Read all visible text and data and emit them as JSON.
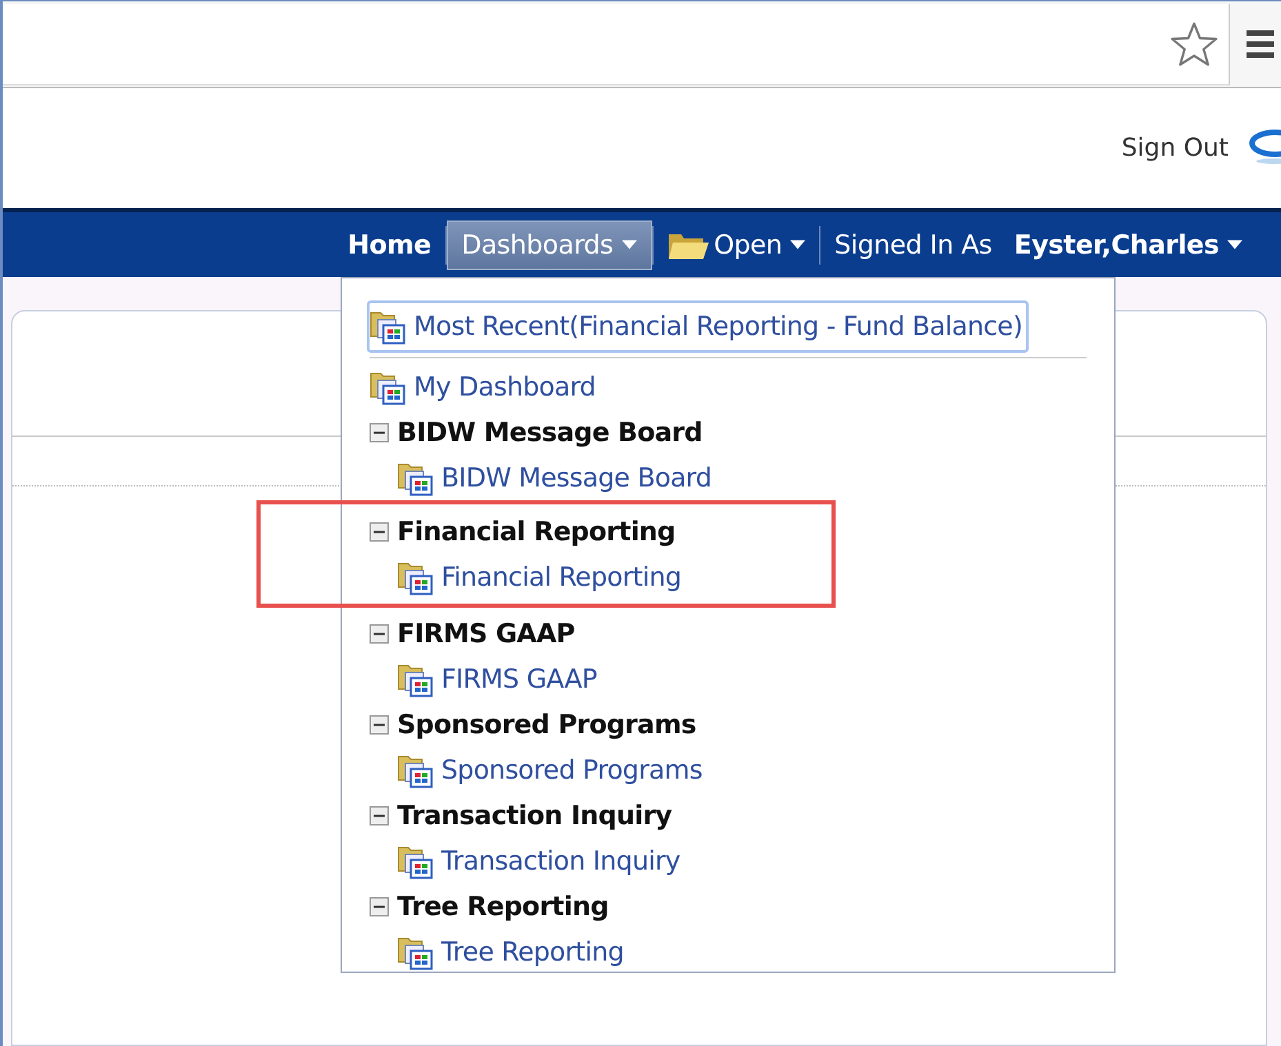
{
  "header": {
    "sign_out": "Sign Out"
  },
  "nav": [
    {
      "label": "Home",
      "kind": "link",
      "selected": false
    },
    {
      "label": "Dashboards",
      "kind": "menu",
      "selected": true
    },
    {
      "label": "Open",
      "kind": "folder-menu",
      "selected": false
    },
    {
      "label": "Signed In As",
      "kind": "caption",
      "selected": false
    },
    {
      "label": "Eyster,Charles",
      "kind": "user-menu",
      "selected": false
    }
  ],
  "menu": {
    "recent": [
      {
        "label": "Most Recent(Financial Reporting - Fund Balance)",
        "focused": true
      },
      {
        "label": "My Dashboard",
        "focused": false
      }
    ],
    "groups": [
      {
        "title": "BIDW Message Board",
        "expanded": true,
        "highlighted": false,
        "children": [
          {
            "label": "BIDW Message Board"
          }
        ]
      },
      {
        "title": "Financial Reporting",
        "expanded": true,
        "highlighted": true,
        "children": [
          {
            "label": "Financial Reporting"
          }
        ]
      },
      {
        "title": "FIRMS GAAP",
        "expanded": true,
        "highlighted": false,
        "children": [
          {
            "label": "FIRMS GAAP"
          }
        ]
      },
      {
        "title": "Sponsored Programs",
        "expanded": true,
        "highlighted": false,
        "children": [
          {
            "label": "Sponsored Programs"
          }
        ]
      },
      {
        "title": "Transaction Inquiry",
        "expanded": true,
        "highlighted": false,
        "children": [
          {
            "label": "Transaction Inquiry"
          }
        ]
      },
      {
        "title": "Tree Reporting",
        "expanded": true,
        "highlighted": false,
        "children": [
          {
            "label": "Tree Reporting"
          }
        ]
      }
    ]
  }
}
